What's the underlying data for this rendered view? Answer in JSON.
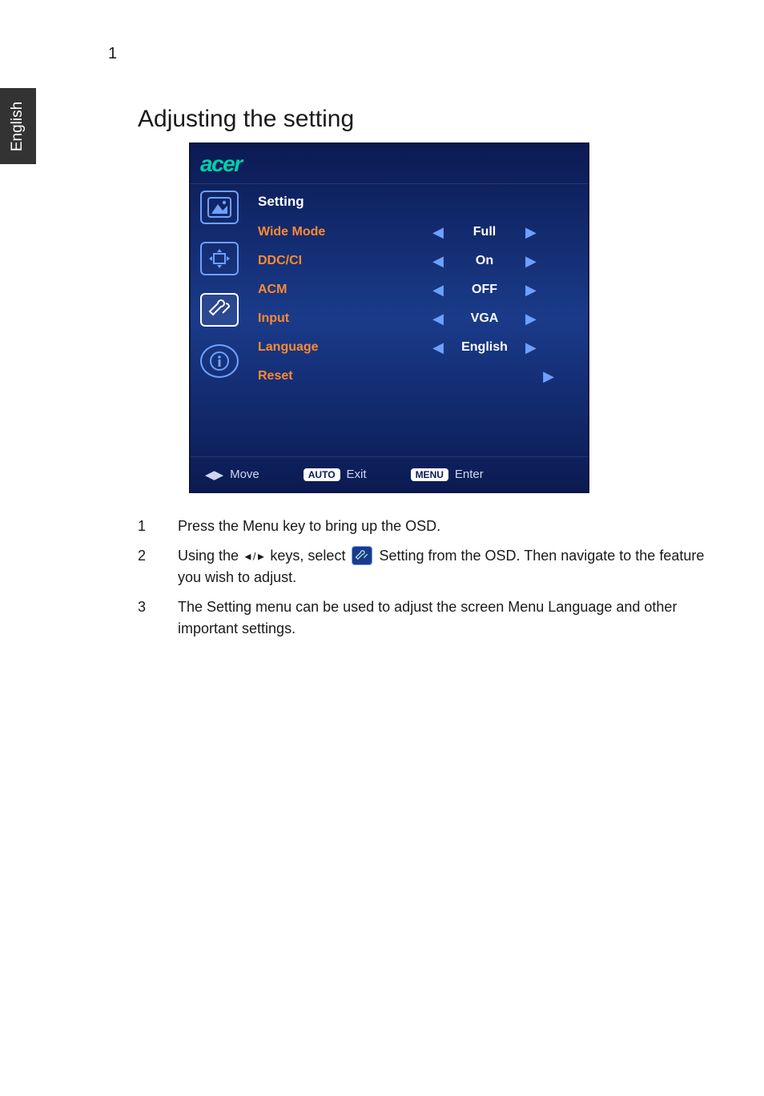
{
  "page_number": "1",
  "side_tab": "English",
  "heading": "Adjusting the setting",
  "osd": {
    "brand": "acer",
    "menu_title": "Setting",
    "rows": [
      {
        "label": "Wide Mode",
        "value": "Full"
      },
      {
        "label": "DDC/CI",
        "value": "On"
      },
      {
        "label": "ACM",
        "value": "OFF"
      },
      {
        "label": "Input",
        "value": "VGA"
      },
      {
        "label": "Language",
        "value": "English"
      }
    ],
    "reset_label": "Reset",
    "footer": {
      "move": "Move",
      "auto_badge": "AUTO",
      "exit": "Exit",
      "menu_badge": "MENU",
      "enter": "Enter"
    },
    "side_icons": [
      "picture-icon",
      "position-icon",
      "tools-icon",
      "info-icon"
    ]
  },
  "instructions": {
    "i1_num": "1",
    "i1": "Press the Menu key to bring up the OSD.",
    "i2_num": "2",
    "i2_a": "Using the ",
    "i2_b": " keys, select ",
    "i2_c": " Setting from the OSD. Then navigate to the feature you wish to adjust.",
    "i3_num": "3",
    "i3": "The Setting menu can be used to adjust the screen Menu Language and other important settings."
  }
}
